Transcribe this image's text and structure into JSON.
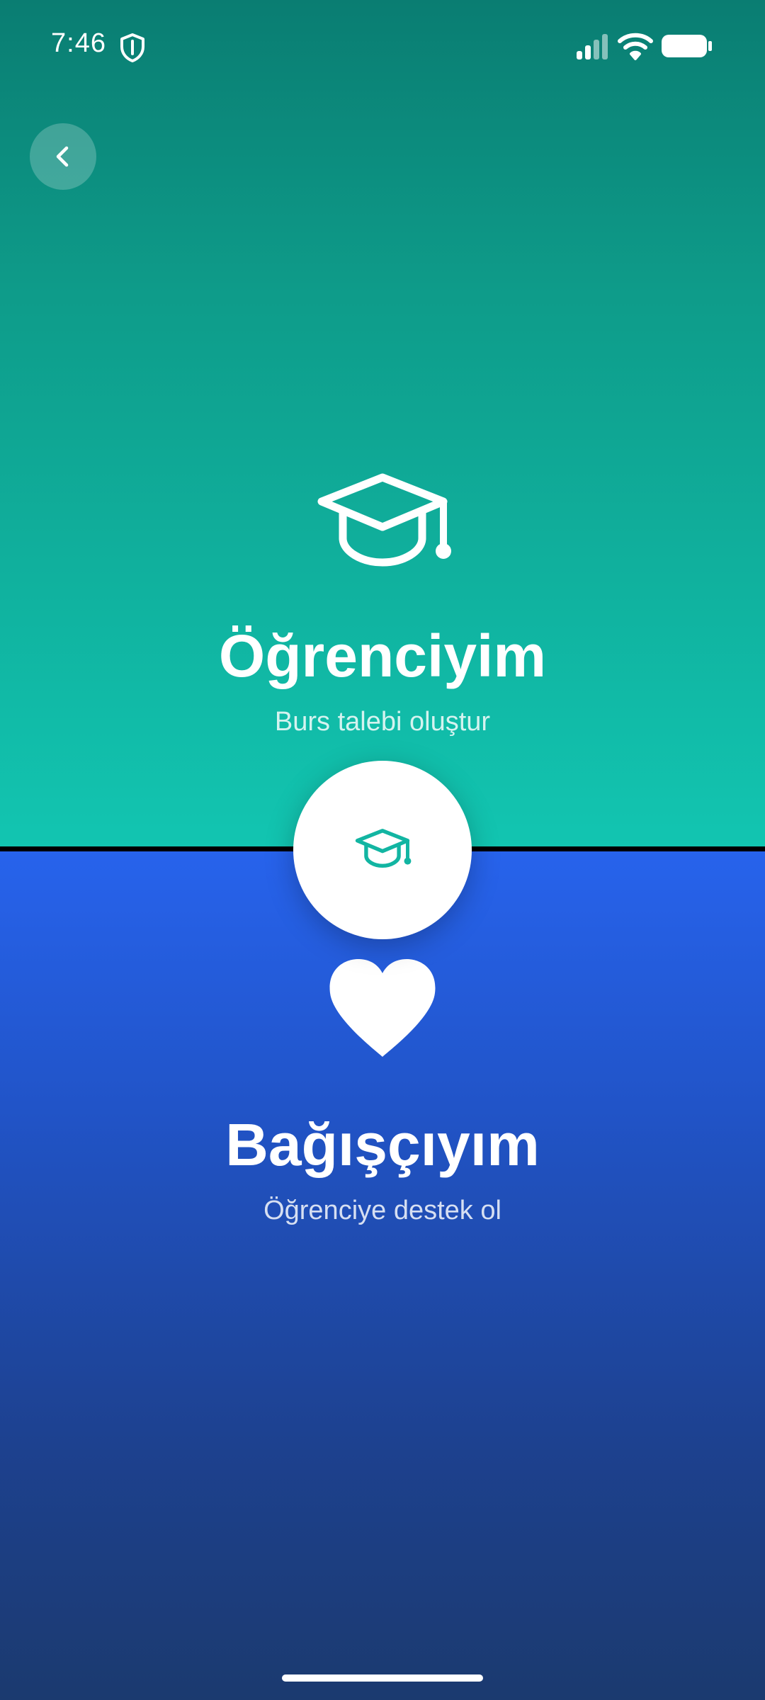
{
  "status_bar": {
    "time": "7:46",
    "icons": [
      "shield-icon",
      "signal-icon",
      "wifi-icon",
      "battery-icon"
    ]
  },
  "back_button": {
    "icon": "chevron-left-icon"
  },
  "student": {
    "icon": "graduation-cap-icon",
    "title": "Öğrenciyim",
    "subtitle": "Burs talebi oluştur"
  },
  "toggle": {
    "icon": "graduation-cap-icon",
    "accent": "#12b5a2"
  },
  "donor": {
    "icon": "heart-icon",
    "title": "Bağışçıyım",
    "subtitle": "Öğrenciye destek ol"
  },
  "colors": {
    "student_top": "#0a7d72",
    "student_bottom": "#12c5b1",
    "donor_top": "#2763ec",
    "donor_bottom": "#1b3a6f"
  }
}
